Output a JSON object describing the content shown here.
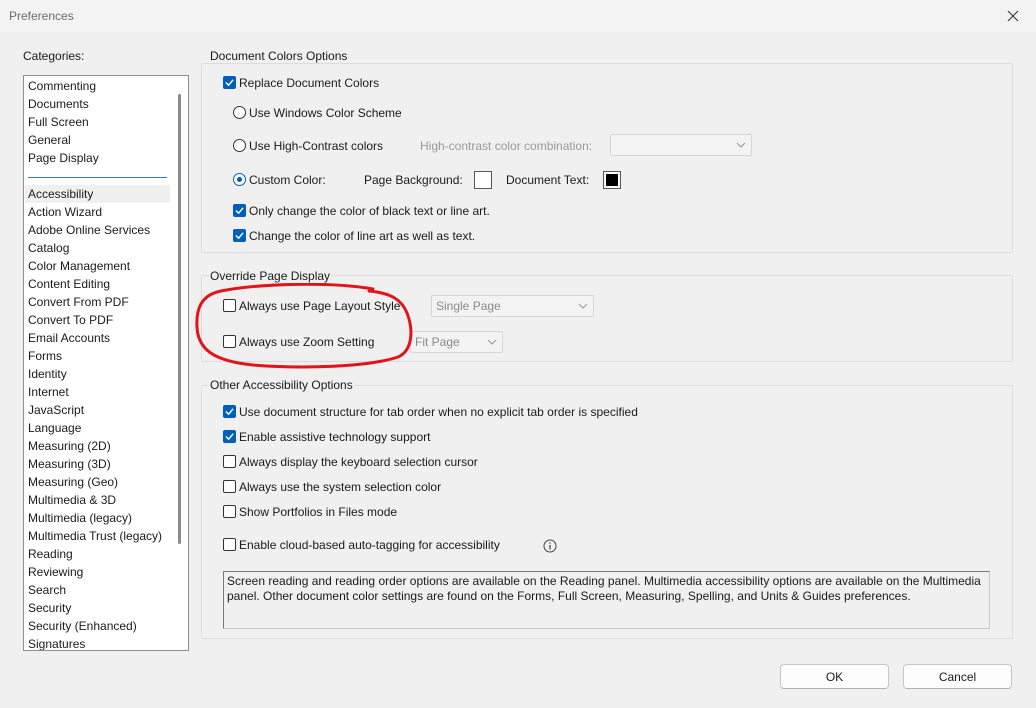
{
  "window": {
    "title": "Preferences"
  },
  "categories": {
    "label": "Categories:",
    "top_items": [
      "Commenting",
      "Documents",
      "Full Screen",
      "General",
      "Page Display"
    ],
    "items": [
      "Accessibility",
      "Action Wizard",
      "Adobe Online Services",
      "Catalog",
      "Color Management",
      "Content Editing",
      "Convert From PDF",
      "Convert To PDF",
      "Email Accounts",
      "Forms",
      "Identity",
      "Internet",
      "JavaScript",
      "Language",
      "Measuring (2D)",
      "Measuring (3D)",
      "Measuring (Geo)",
      "Multimedia & 3D",
      "Multimedia (legacy)",
      "Multimedia Trust (legacy)",
      "Reading",
      "Reviewing",
      "Search",
      "Security",
      "Security (Enhanced)",
      "Signatures"
    ],
    "selected": "Accessibility"
  },
  "doc_colors": {
    "title": "Document Colors Options",
    "replace_label": "Replace Document Colors",
    "replace_checked": true,
    "windows_scheme_label": "Use Windows Color Scheme",
    "high_contrast_label": "Use High-Contrast colors",
    "high_contrast_combo_label": "High-contrast color combination:",
    "high_contrast_combo_value": "",
    "custom_color_label": "Custom Color:",
    "selected_option": "Custom Color:",
    "page_background_label": "Page Background:",
    "page_background_color": "#ffffff",
    "document_text_label": "Document Text:",
    "document_text_color": "#000000",
    "only_black_label": "Only change the color of black text or line art.",
    "only_black_checked": true,
    "line_art_label": "Change the color of line art as well as text.",
    "line_art_checked": true
  },
  "override": {
    "title": "Override Page Display",
    "layout_label": "Always use Page Layout Style",
    "layout_checked": false,
    "layout_value": "Single Page",
    "zoom_label": "Always use Zoom Setting",
    "zoom_checked": false,
    "zoom_value": "Fit Page"
  },
  "other": {
    "title": "Other Accessibility Options",
    "options": [
      {
        "label": "Use document structure for tab order when no explicit tab order is specified",
        "checked": true
      },
      {
        "label": "Enable assistive technology support",
        "checked": true
      },
      {
        "label": "Always display the keyboard selection cursor",
        "checked": false
      },
      {
        "label": "Always use the system selection color",
        "checked": false
      },
      {
        "label": "Show Portfolios in Files mode",
        "checked": false
      }
    ],
    "auto_tag_label": "Enable cloud-based auto-tagging for accessibility",
    "auto_tag_checked": false,
    "info_text": "Screen reading and reading order options are available on the Reading panel. Multimedia accessibility options are available on the Multimedia panel. Other document color settings are found on the Forms, Full Screen, Measuring, Spelling, and Units & Guides preferences."
  },
  "buttons": {
    "ok": "OK",
    "cancel": "Cancel"
  },
  "colors": {
    "accent": "#005fb8",
    "annotation": "#e0151b"
  }
}
